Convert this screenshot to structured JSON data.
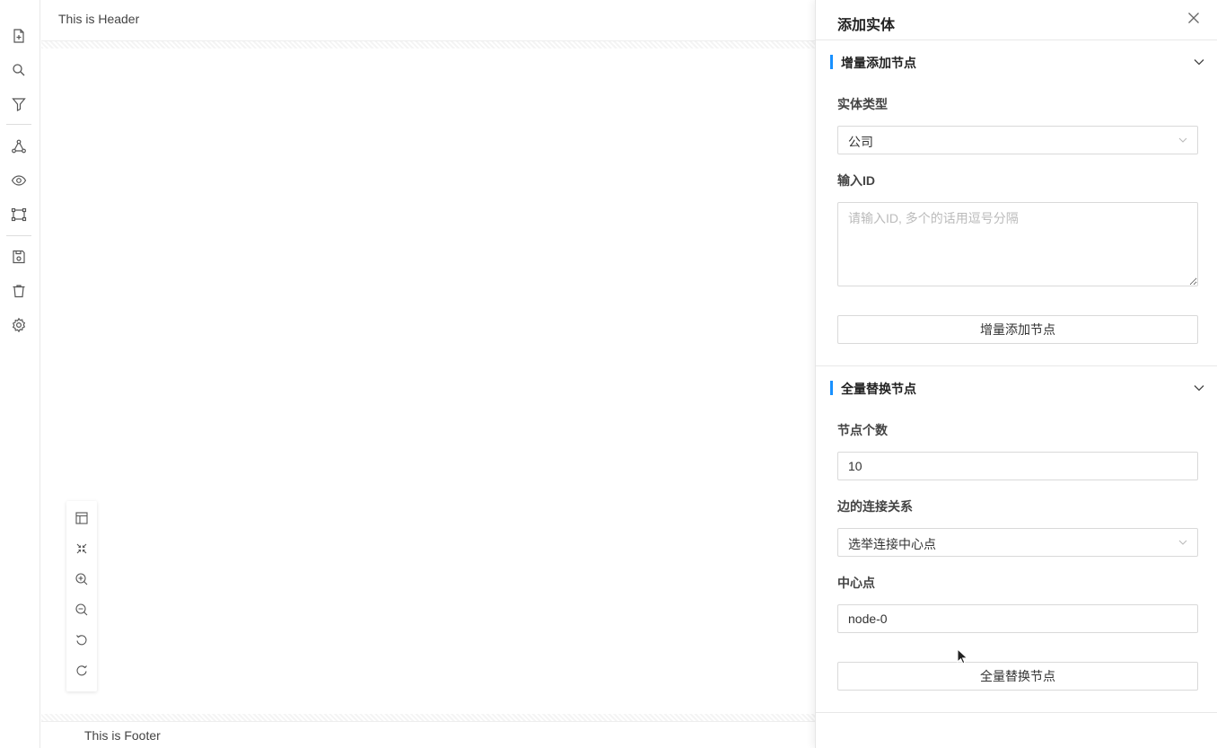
{
  "header": {
    "title": "This is Header"
  },
  "footer": {
    "title": "This is Footer"
  },
  "sidebar": {
    "icons": [
      "new-file-icon",
      "search-icon",
      "filter-icon",
      "network-icon",
      "eye-icon",
      "shape-icon",
      "save-icon",
      "trash-icon",
      "settings-icon"
    ]
  },
  "graph_controls": {
    "icons": [
      "minimap-icon",
      "fit-view-icon",
      "zoom-in-icon",
      "zoom-out-icon",
      "undo-icon",
      "redo-icon"
    ]
  },
  "drawer": {
    "title": "添加实体",
    "incremental": {
      "title": "增量添加节点",
      "entity_type_label": "实体类型",
      "entity_type_value": "公司",
      "id_label": "输入ID",
      "id_placeholder": "请输入ID, 多个的话用逗号分隔",
      "button_label": "增量添加节点"
    },
    "full_replace": {
      "title": "全量替换节点",
      "node_count_label": "节点个数",
      "node_count_value": "10",
      "edge_label": "边的连接关系",
      "edge_value": "选举连接中心点",
      "center_label": "中心点",
      "center_value": "node-0",
      "button_label": "全量替换节点"
    }
  },
  "colors": {
    "accent": "#1890ff",
    "border": "#d9d9d9"
  }
}
